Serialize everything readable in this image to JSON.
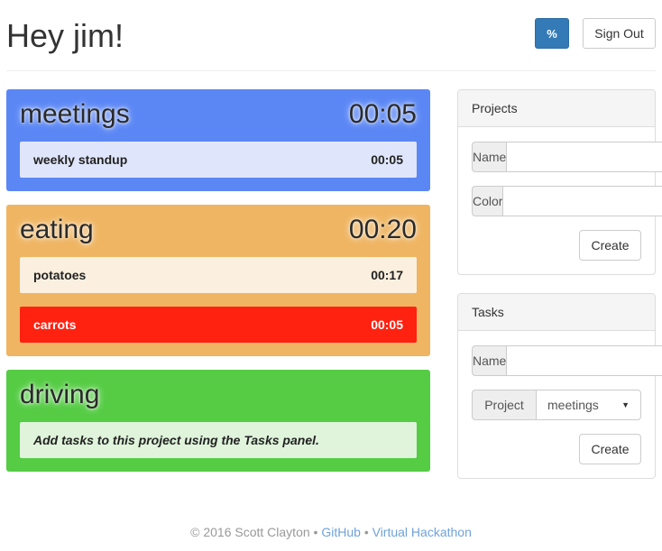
{
  "header": {
    "greeting": "Hey jim!",
    "percent_label": "%",
    "signout_label": "Sign Out"
  },
  "colors": {
    "primary": "#337ab7",
    "meetings": "#5b87f5",
    "eating": "#efb562",
    "driving": "#55cc44",
    "carrots_task": "#ff2211"
  },
  "projects": [
    {
      "name": "meetings",
      "time": "00:05",
      "tasks": [
        {
          "name": "weekly standup",
          "time": "00:05"
        }
      ]
    },
    {
      "name": "eating",
      "time": "00:20",
      "tasks": [
        {
          "name": "potatoes",
          "time": "00:17"
        },
        {
          "name": "carrots",
          "time": "00:05"
        }
      ]
    },
    {
      "name": "driving",
      "time": "",
      "empty_message": "Add tasks to this project using the Tasks panel."
    }
  ],
  "projects_panel": {
    "title": "Projects",
    "name_label": "Name",
    "name_value": "",
    "color_label": "Color",
    "color_value": "",
    "create_label": "Create"
  },
  "tasks_panel": {
    "title": "Tasks",
    "name_label": "Name",
    "name_value": "",
    "project_label": "Project",
    "project_selected": "meetings",
    "create_label": "Create"
  },
  "footer": {
    "copyright": "© 2016 Scott Clayton",
    "separator": "•",
    "github_link": "GitHub",
    "hackathon_link": "Virtual Hackathon"
  }
}
